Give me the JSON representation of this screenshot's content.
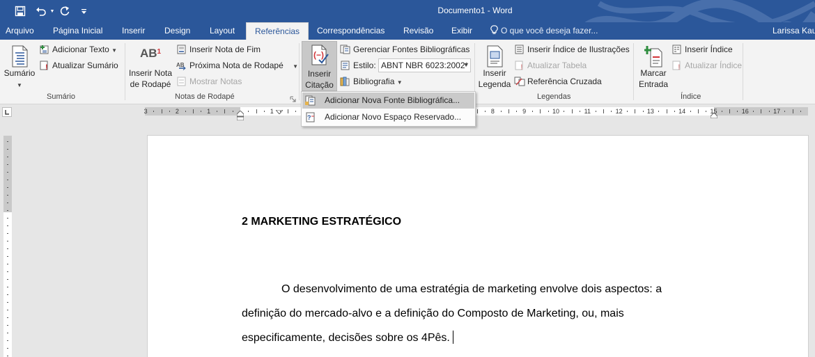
{
  "titlebar": {
    "title": "Documento1 - Word",
    "qat": {
      "save_icon": "save-icon",
      "undo_icon": "undo-icon",
      "redo_icon": "redo-icon",
      "customize_icon": "customize-qat-icon"
    }
  },
  "tabs": [
    {
      "label": "Arquivo"
    },
    {
      "label": "Página Inicial"
    },
    {
      "label": "Inserir"
    },
    {
      "label": "Design"
    },
    {
      "label": "Layout"
    },
    {
      "label": "Referências"
    },
    {
      "label": "Correspondências"
    },
    {
      "label": "Revisão"
    },
    {
      "label": "Exibir"
    }
  ],
  "tell_me": "O que você deseja fazer...",
  "user": "Larissa Kaue",
  "ribbon": {
    "sumario": {
      "group_label": "Sumário",
      "sumario_button": "Sumário",
      "adicionar_texto": "Adicionar Texto",
      "atualizar_sumario": "Atualizar Sumário"
    },
    "notas": {
      "group_label": "Notas de Rodapé",
      "inserir_nota_line1": "Inserir Nota",
      "inserir_nota_line2": "de Rodapé",
      "inserir_nota_fim": "Inserir Nota de Fim",
      "proxima_nota": "Próxima Nota de Rodapé",
      "mostrar_notas": "Mostrar Notas",
      "ab_glyph": "AB",
      "ab_sup": "1"
    },
    "citacoes": {
      "inserir_citacao_line1": "Inserir",
      "inserir_citacao_line2": "Citação",
      "gerenciar_fontes": "Gerenciar Fontes Bibliográficas",
      "estilo_label": "Estilo:",
      "estilo_value": "ABNT NBR 6023:2002*",
      "bibliografia": "Bibliografia"
    },
    "legendas": {
      "group_label": "Legendas",
      "inserir_legenda_line1": "Inserir",
      "inserir_legenda_line2": "Legenda",
      "inserir_indice_ilustracoes": "Inserir Índice de Ilustrações",
      "atualizar_tabela": "Atualizar Tabela",
      "referencia_cruzada": "Referência Cruzada"
    },
    "indice": {
      "group_label": "Índice",
      "marcar_entrada_line1": "Marcar",
      "marcar_entrada_line2": "Entrada",
      "inserir_indice": "Inserir Índice",
      "atualizar_indice": "Atualizar Índice"
    }
  },
  "citation_menu": {
    "items": [
      {
        "label": "Adicionar Nova Fonte Bibliográfica...",
        "highlighted": true
      },
      {
        "label": "Adicionar Novo Espaço Reservado...",
        "highlighted": false
      }
    ]
  },
  "ruler": {
    "labels": [
      "3",
      "2",
      "1",
      "1",
      "2",
      "3",
      "4",
      "5",
      "6",
      "7",
      "8",
      "9",
      "10",
      "11",
      "12",
      "13",
      "14",
      "15",
      "16",
      "17"
    ]
  },
  "document": {
    "heading": "2 MARKETING ESTRATÉGICO",
    "paragraph_lines": [
      "O desenvolvimento de uma estratégia de marketing envolve dois aspectos: a",
      "definição do mercado-alvo e a definição do Composto de Marketing, ou, mais",
      "especificamente, decisões sobre os 4Pês."
    ]
  },
  "colors": {
    "title_bar": "#2b579a",
    "ribbon_bg": "#f3f3f3",
    "canvas_bg": "#e6e6e6",
    "menu_highlight": "#cacaca"
  }
}
